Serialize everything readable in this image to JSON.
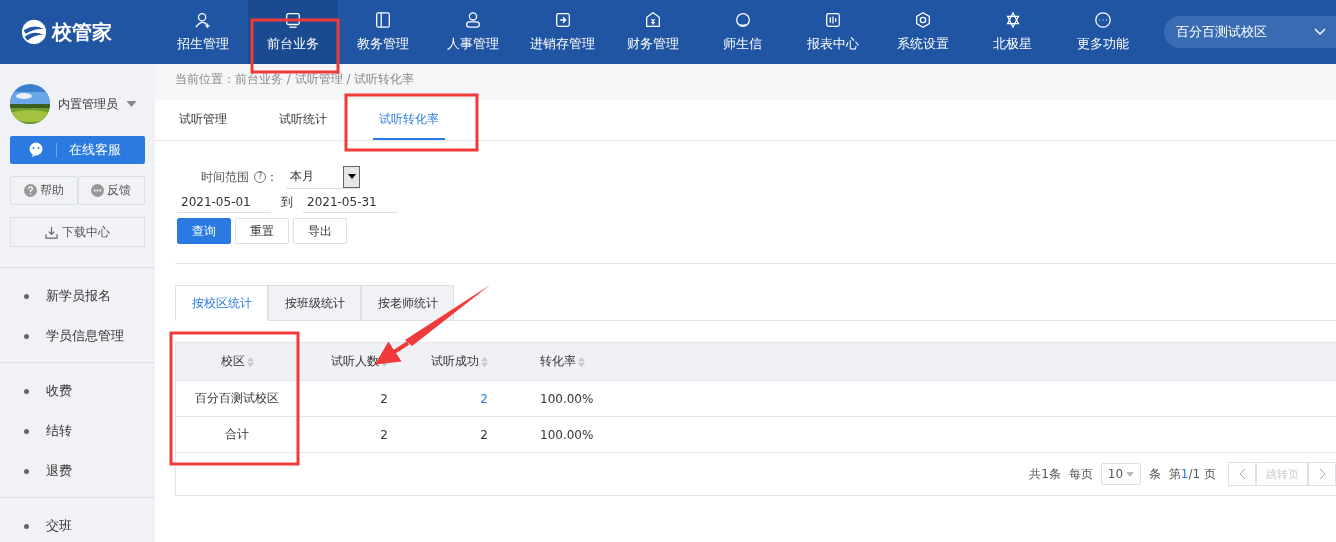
{
  "logo": {
    "text": "校管家"
  },
  "nav": [
    {
      "label": "招生管理",
      "selected": false
    },
    {
      "label": "前台业务",
      "selected": true
    },
    {
      "label": "教务管理",
      "selected": false
    },
    {
      "label": "人事管理",
      "selected": false
    },
    {
      "label": "进销存管理",
      "selected": false
    },
    {
      "label": "财务管理",
      "selected": false
    },
    {
      "label": "师生信",
      "selected": false
    },
    {
      "label": "报表中心",
      "selected": false
    },
    {
      "label": "系统设置",
      "selected": false
    },
    {
      "label": "北极星",
      "selected": false
    },
    {
      "label": "更多功能",
      "selected": false
    }
  ],
  "campus_select": {
    "value": "百分百测试校区"
  },
  "sidebar": {
    "user": "内置管理员",
    "service_button": "在线客服",
    "help": "帮助",
    "feedback": "反馈",
    "download": "下载中心",
    "sections": [
      [
        "新学员报名",
        "学员信息管理"
      ],
      [
        "收费",
        "结转",
        "退费"
      ],
      [
        "交班"
      ]
    ]
  },
  "breadcrumb": "当前位置：前台业务 / 试听管理 / 试听转化率",
  "tabs": [
    {
      "label": "试听管理",
      "selected": false
    },
    {
      "label": "试听统计",
      "selected": false
    },
    {
      "label": "试听转化率",
      "selected": true
    }
  ],
  "filter": {
    "label": "时间范围",
    "colon": "：",
    "help_icon": "?",
    "period": "本月",
    "date_from": "2021-05-01",
    "to": "到",
    "date_to": "2021-05-31"
  },
  "buttons": [
    {
      "label": "查询",
      "kind": "primary"
    },
    {
      "label": "重置",
      "kind": "default"
    },
    {
      "label": "导出",
      "kind": "default"
    }
  ],
  "subtabs": [
    {
      "label": "按校区统计",
      "selected": true
    },
    {
      "label": "按班级统计",
      "selected": false
    },
    {
      "label": "按老师统计",
      "selected": false
    }
  ],
  "table": {
    "columns": [
      "校区",
      "试听人数",
      "试听成功",
      "转化率"
    ],
    "rows": [
      {
        "cells": [
          "百分百测试校区",
          "2",
          "2",
          "100.00%"
        ],
        "link": true
      },
      {
        "cells": [
          "合计",
          "2",
          "2",
          "100.00%"
        ],
        "link": false
      }
    ]
  },
  "pagination": {
    "total": "共1条",
    "per_page_label": "每页",
    "per_page": "10",
    "unit": "条",
    "page_prefix": "第",
    "page_current": "1",
    "page_suffix": "/1 页",
    "jump": "跳转页"
  },
  "annotations": [
    {
      "kind": "box"
    },
    {
      "kind": "box"
    },
    {
      "kind": "box"
    },
    {
      "kind": "arrow"
    }
  ]
}
